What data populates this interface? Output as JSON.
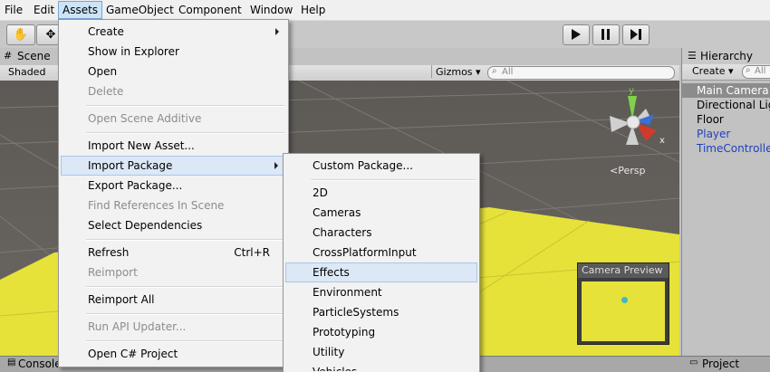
{
  "menubar": {
    "items": [
      "File",
      "Edit",
      "Assets",
      "GameObject",
      "Component",
      "Window",
      "Help"
    ]
  },
  "scene": {
    "tab_label": "Scene",
    "shading": "Shaded",
    "gizmos": "Gizmos",
    "search_placeholder": "All",
    "persp_label": "Persp"
  },
  "gizmo_axes": {
    "x": "x",
    "y": "y"
  },
  "camera_preview": {
    "title": "Camera Preview"
  },
  "hierarchy": {
    "tab_label": "Hierarchy",
    "create_label": "Create",
    "search_placeholder": "All",
    "items": [
      "Main Camera",
      "Directional Ligh",
      "Floor",
      "Player",
      "TimeControlle"
    ]
  },
  "bottom": {
    "console_label": "Console",
    "project_label": "Project"
  },
  "assets_menu": {
    "items": [
      {
        "label": "Create"
      },
      {
        "label": "Show in Explorer"
      },
      {
        "label": "Open"
      },
      {
        "label": "Delete"
      },
      {
        "label": "Open Scene Additive"
      },
      {
        "label": "Import New Asset..."
      },
      {
        "label": "Import Package"
      },
      {
        "label": "Export Package..."
      },
      {
        "label": "Find References In Scene"
      },
      {
        "label": "Select Dependencies"
      },
      {
        "label": "Refresh",
        "shortcut": "Ctrl+R"
      },
      {
        "label": "Reimport"
      },
      {
        "label": "Reimport All"
      },
      {
        "label": "Run API Updater..."
      },
      {
        "label": "Open C# Project"
      }
    ]
  },
  "import_package_menu": {
    "items": [
      "Custom Package...",
      "2D",
      "Cameras",
      "Characters",
      "CrossPlatformInput",
      "Effects",
      "Environment",
      "ParticleSystems",
      "Prototyping",
      "Utility",
      "Vehicles"
    ]
  },
  "colors": {
    "floor": "#e6e23a",
    "menu_highlight": "#dce8f6",
    "active_menubar": "#cce4f7",
    "hierarchy_selected": "#8c8c8c",
    "prefab_text": "#1f3fc0"
  }
}
